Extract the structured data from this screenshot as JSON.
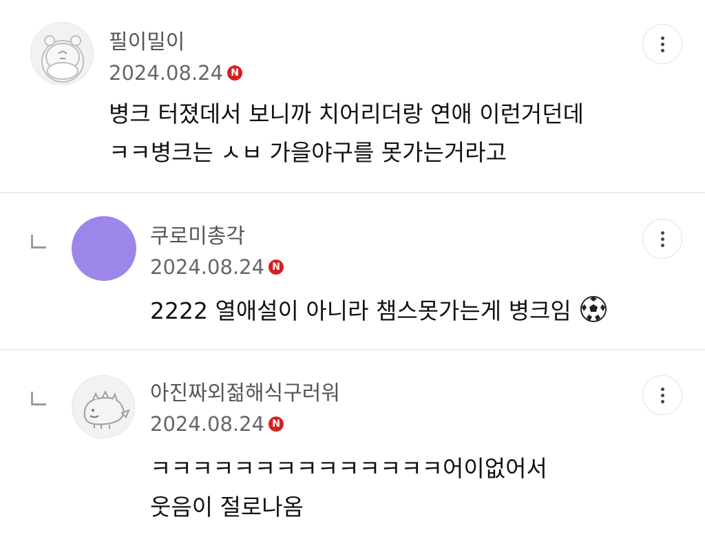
{
  "comments": [
    {
      "nickname": "필이밀이",
      "date": "2024.08.24",
      "badge": "N",
      "lines": [
        "병크 터졌데서 보니까 치어리더랑 연애 이런거던데",
        "ㅋㅋ병크는 ㅅㅂ 가을야구를 못가는거라고"
      ],
      "avatar_icon": "hippo-avatar-icon",
      "is_reply": false
    },
    {
      "nickname": "쿠로미총각",
      "date": "2024.08.24",
      "badge": "N",
      "lines": [
        "2222 열애설이 아니라 챔스못가는게 병크임"
      ],
      "avatar_color": "#9d86ea",
      "trailing_emoji": "soccer-ball-icon",
      "is_reply": true
    },
    {
      "nickname": "아진짜외젊해식구러워",
      "date": "2024.08.24",
      "badge": "N",
      "lines": [
        "ㅋㅋㅋㅋㅋㅋㅋㅋㅋㅋㅋㅋㅋㅋ어이없어서",
        "웃음이 절로나옴"
      ],
      "avatar_icon": "creature-avatar-icon",
      "is_reply": true
    }
  ],
  "colors": {
    "badge": "#d71f1f",
    "nickname": "#555555",
    "divider": "#ececec"
  }
}
